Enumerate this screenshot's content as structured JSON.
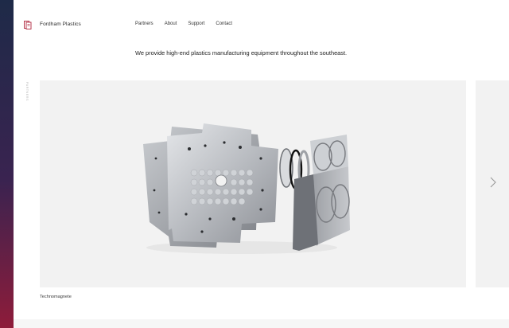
{
  "brand": {
    "name": "Fordham Plastics",
    "logo_icon": "stacked-plates-logo-icon",
    "accent_top": "#1e2a48",
    "accent_bottom": "#8e1c3a",
    "logo_color": "#b0263d"
  },
  "nav": {
    "items": [
      {
        "label": "Partners"
      },
      {
        "label": "About"
      },
      {
        "label": "Support"
      },
      {
        "label": "Contact"
      }
    ]
  },
  "hero": {
    "tagline": "We provide high-end plastics manufacturing equipment throughout the southeast."
  },
  "sidebar": {
    "label": "PARTNERS"
  },
  "carousel": {
    "slides": [
      {
        "caption": "Technomagnete",
        "image_icon": "mold-plates-exploded-view-image"
      }
    ],
    "next_icon": "chevron-right-icon"
  }
}
